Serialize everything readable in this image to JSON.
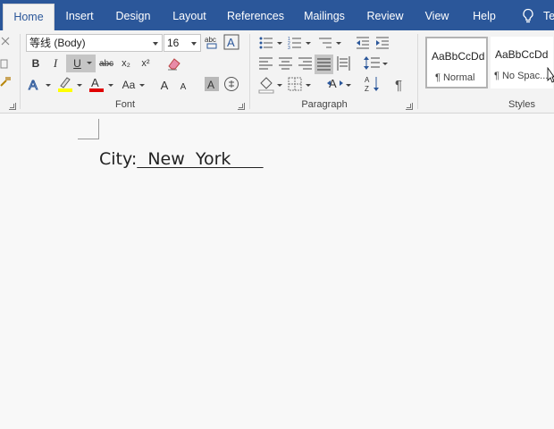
{
  "tabs": [
    {
      "label": "Home",
      "active": true
    },
    {
      "label": "Insert"
    },
    {
      "label": "Design"
    },
    {
      "label": "Layout"
    },
    {
      "label": "References"
    },
    {
      "label": "Mailings"
    },
    {
      "label": "Review"
    },
    {
      "label": "View"
    },
    {
      "label": "Help"
    }
  ],
  "tell_me_partial": "Te",
  "font": {
    "name": "等线 (Body)",
    "size": "16",
    "group_label": "Font",
    "bold": "B",
    "italic": "I",
    "underline": "U",
    "strike": "abc",
    "subscript": "x₂",
    "superscript": "x²",
    "change_case": "Aa",
    "grow": "A",
    "shrink": "A"
  },
  "paragraph": {
    "group_label": "Paragraph",
    "pilcrow": "¶"
  },
  "styles": {
    "group_label": "Styles",
    "items": [
      {
        "sample": "AaBbCcDd",
        "name": "¶ Normal"
      },
      {
        "sample": "AaBbCcDd",
        "name": "¶ No Spac..."
      }
    ]
  },
  "colors": {
    "accent": "#2b579a",
    "highlight": "#ffff00",
    "font_color": "#e00000"
  },
  "document": {
    "label": "City:",
    "value": "  New  York      "
  }
}
